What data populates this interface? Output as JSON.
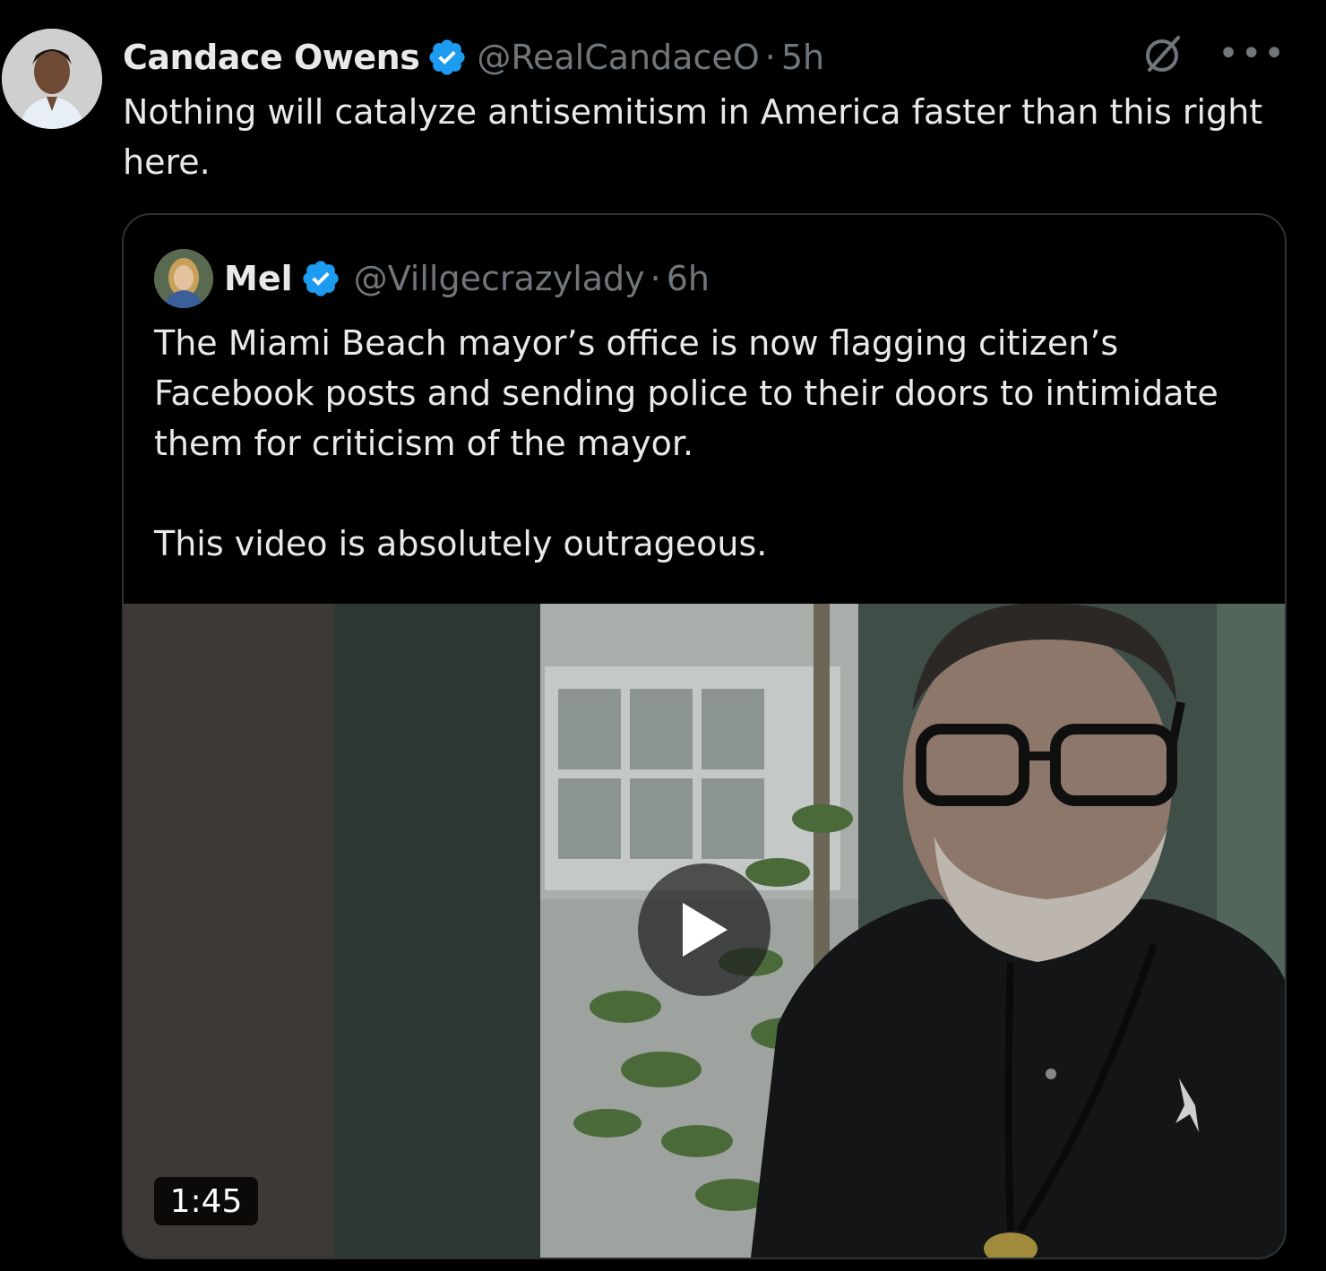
{
  "tweet": {
    "author_name": "Candace Owens",
    "handle": "@RealCandaceO",
    "separator": "·",
    "time": "5h",
    "text": "Nothing will catalyze antisemitism in America faster than this right here.",
    "icons": {
      "avatar": "avatar",
      "verified": "verified-badge-icon",
      "grok": "grok-icon",
      "more": "more-options-icon"
    },
    "more_label": "•••"
  },
  "quote": {
    "author_name": "Mel",
    "handle": "@Villgecrazylady",
    "separator": "·",
    "time": "6h",
    "text_lines": [
      "The Miami Beach mayor’s office is now flagging citizen’s Facebook posts and sending police to their doors to intimidate them for criticism of the mayor.",
      "This video is absolutely outrageous."
    ],
    "media": {
      "type": "video",
      "duration": "1:45",
      "icons": {
        "play": "play-icon"
      }
    }
  },
  "colors": {
    "background": "#000000",
    "text": "#e7e9ea",
    "secondary_text": "#71767b",
    "verified_blue": "#1d9bf0",
    "border": "#2f3336"
  }
}
